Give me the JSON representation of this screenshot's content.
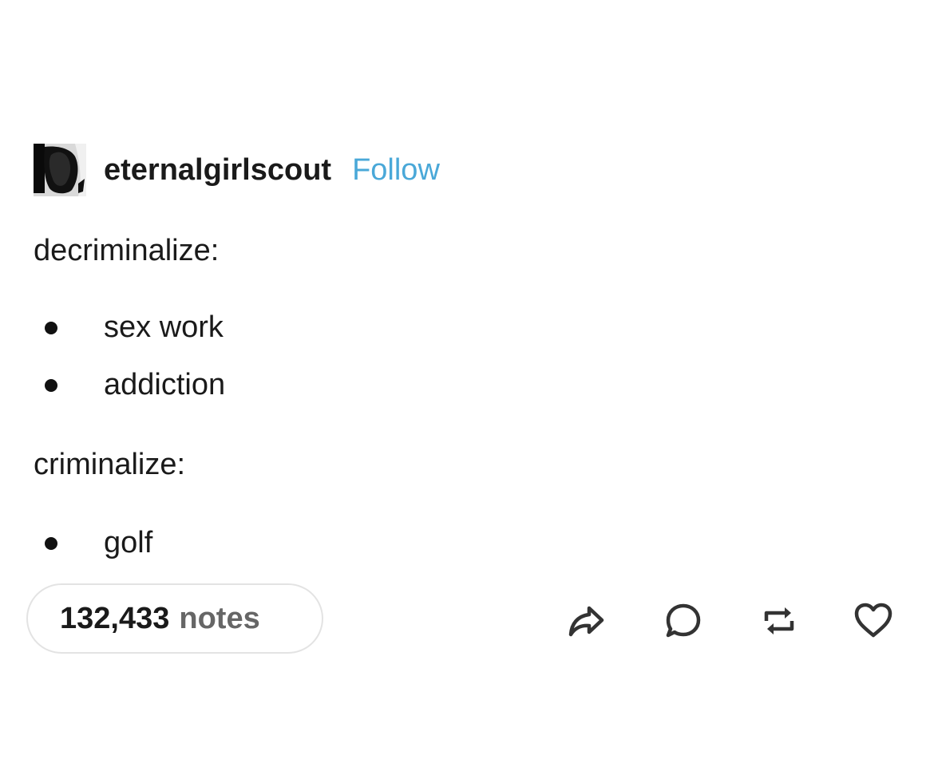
{
  "post": {
    "author": {
      "username": "eternalgirlscout",
      "follow_label": "Follow",
      "avatar_icon": "avatar-icon"
    },
    "sections": [
      {
        "heading": "decriminalize:",
        "items": [
          "sex work",
          "addiction"
        ]
      },
      {
        "heading": "criminalize:",
        "items": [
          "golf"
        ]
      }
    ],
    "notes": {
      "count": "132,433",
      "label": "notes"
    },
    "actions": [
      {
        "icon": "share-icon"
      },
      {
        "icon": "reply-icon"
      },
      {
        "icon": "reblog-icon"
      },
      {
        "icon": "like-icon"
      }
    ],
    "colors": {
      "follow": "#4aa8d8",
      "text": "#1a1a1a",
      "muted": "#666666",
      "pill_border": "#e3e3e3"
    }
  }
}
